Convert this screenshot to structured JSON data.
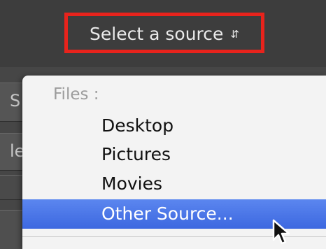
{
  "source_select": {
    "label": "Select a source",
    "icon": "updown-arrows-icon",
    "highlight_color": "#e8231c"
  },
  "dropdown": {
    "group_heading": "Files :",
    "items": [
      {
        "label": "Desktop",
        "selected": false
      },
      {
        "label": "Pictures",
        "selected": false
      },
      {
        "label": "Movies",
        "selected": false
      },
      {
        "label": "Other Source...",
        "selected": true
      }
    ],
    "selected_color": "#3d68e0"
  },
  "background_partial": {
    "glyph_1": "S",
    "glyph_2": "le"
  },
  "cursor": {
    "icon": "arrow-cursor-icon"
  }
}
